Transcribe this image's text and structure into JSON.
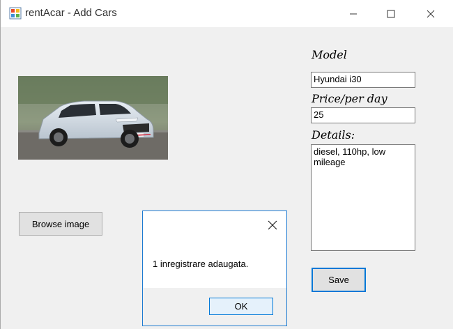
{
  "window": {
    "title": "rentAcar - Add Cars",
    "icons": {
      "app": "windows-forms-app-icon",
      "minimize": "minimize-icon",
      "maximize": "maximize-icon",
      "close": "close-icon"
    }
  },
  "form": {
    "model_label": "Model",
    "model_value": "Hyundai i30",
    "price_label": "Price/per day",
    "price_value": "25",
    "details_label": "Details:",
    "details_value": "diesel, 110hp, low mileage",
    "browse_button": "Browse image",
    "save_button": "Save",
    "car_image": "car-photo"
  },
  "messagebox": {
    "message": "1 inregistrare adaugata.",
    "ok_button": "OK",
    "close_icon": "close-icon"
  },
  "colors": {
    "accent": "#0078d7",
    "window_bg": "#f0f0f0",
    "button_bg": "#e1e1e1"
  }
}
